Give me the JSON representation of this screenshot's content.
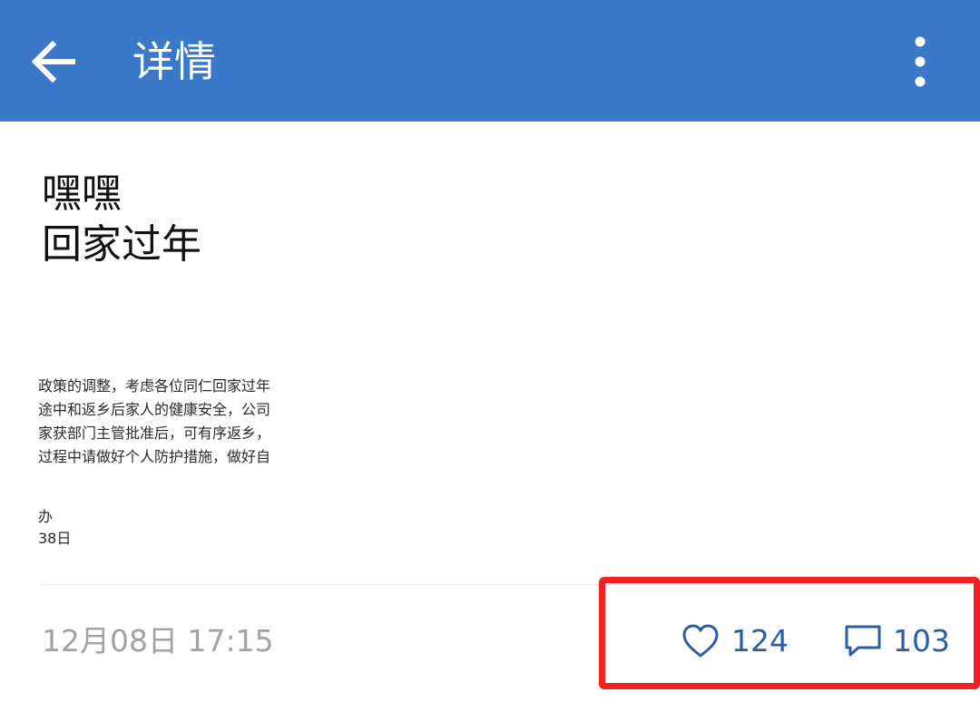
{
  "appbar": {
    "title": "详情",
    "back_icon": "arrow-left-icon",
    "more_icon": "more-vertical-icon",
    "background_color": "#3a78c9"
  },
  "post": {
    "title_lines": [
      "嘿嘿",
      "回家过年"
    ],
    "image_text_lines": [
      "政策的调整，考虑各位同仁回家过年",
      "途中和返乡后家人的健康安全，公司",
      "家获部门主管批准后，可有序返乡，",
      "过程中请做好个人防护措施，做好自",
      "办",
      "38日"
    ],
    "time": "12月08日 17:15",
    "likes": {
      "icon": "heart-icon",
      "count": "124"
    },
    "comments": {
      "icon": "comment-icon",
      "count": "103"
    }
  },
  "colors": {
    "accent_text": "#2b5ea7",
    "highlight_border": "#f41f1f",
    "muted_text": "#a3a3a3"
  }
}
